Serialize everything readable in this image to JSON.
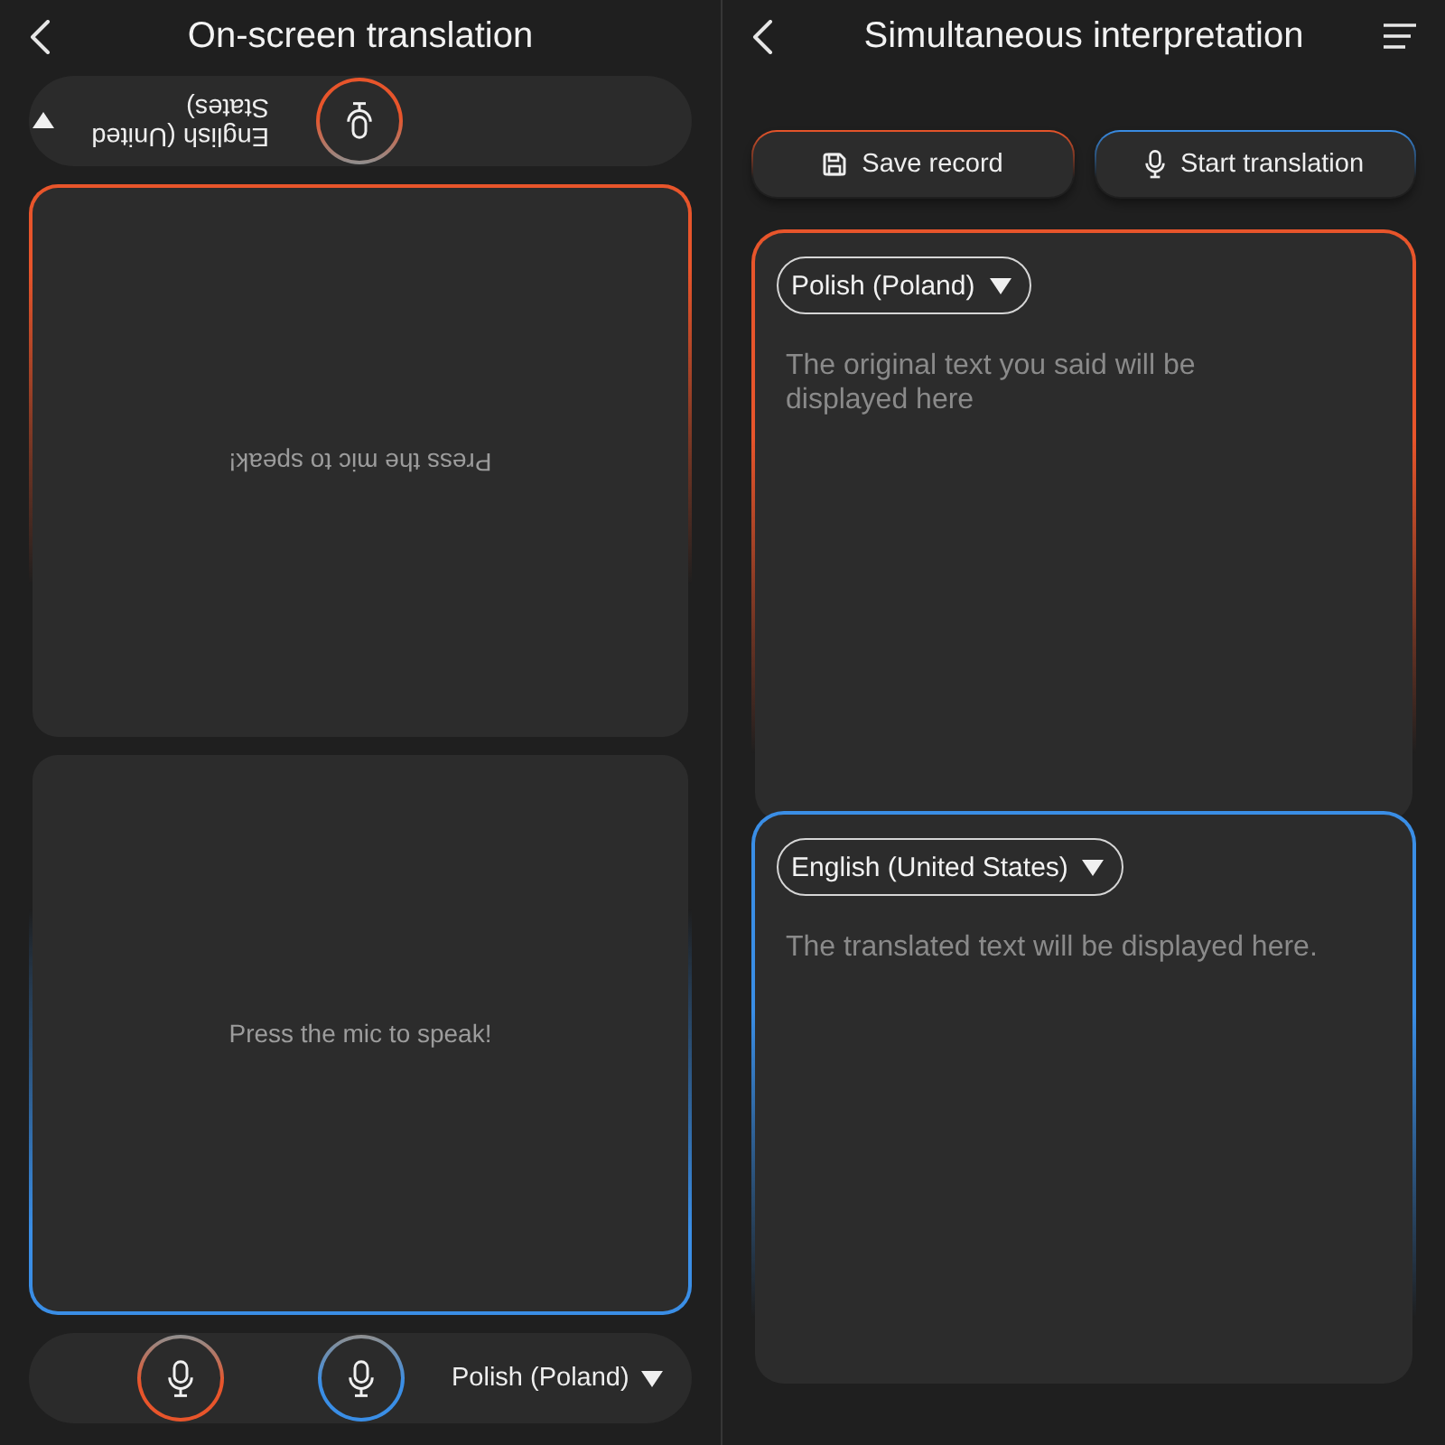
{
  "left_screen": {
    "title": "On-screen translation",
    "top_bar": {
      "upside_down": true,
      "mics": [
        {
          "color": "#e8552b"
        }
      ],
      "language": "English (United States)"
    },
    "panels": [
      {
        "upside_down": true,
        "prompt": "Press the mic to speak!",
        "color": "#e8552b"
      },
      {
        "upside_down": false,
        "prompt": "Press the mic to speak!",
        "color": "#3a8ee6"
      }
    ],
    "bottom_bar": {
      "upside_down": false,
      "mics": [
        {
          "color": "#e8552b"
        },
        {
          "color": "#3a8ee6"
        }
      ],
      "language": "Polish (Poland)"
    }
  },
  "right_screen": {
    "title": "Simultaneous interpretation",
    "buttons": [
      {
        "kind": "save",
        "label": "Save record",
        "color": "#e8552b"
      },
      {
        "kind": "translate",
        "label": "Start translation",
        "color": "#3a8ee6"
      }
    ],
    "cards": [
      {
        "language": "Polish (Poland)",
        "placeholder": "The original text you said will be displayed here",
        "color": "#e8552b"
      },
      {
        "language": "English (United States)",
        "placeholder": "The translated text will be displayed here.",
        "color": "#3a8ee6"
      }
    ]
  }
}
